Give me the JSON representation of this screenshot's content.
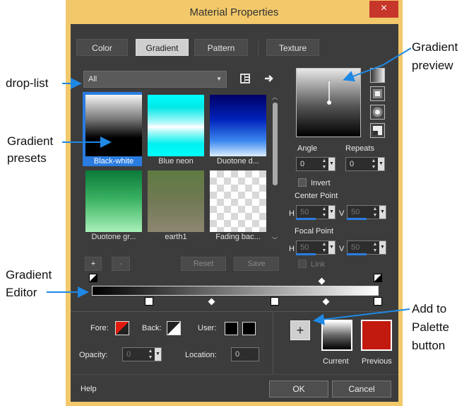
{
  "window": {
    "title": "Material Properties",
    "close_glyph": "×"
  },
  "tabs": [
    {
      "label": "Color",
      "active": false
    },
    {
      "label": "Gradient",
      "active": true
    },
    {
      "label": "Pattern",
      "active": false
    },
    {
      "label": "Texture",
      "active": false
    }
  ],
  "droplist": {
    "value": "All"
  },
  "presets": [
    {
      "label": "Black-white",
      "selected": true
    },
    {
      "label": "Blue neon",
      "selected": false
    },
    {
      "label": "Duotone d...",
      "selected": false
    },
    {
      "label": "Duotone gr...",
      "selected": false
    },
    {
      "label": "earth1",
      "selected": false
    },
    {
      "label": "Fading bac...",
      "selected": false
    }
  ],
  "preset_buttons": {
    "add": "+",
    "remove": "-",
    "reset": "Reset",
    "save": "Save"
  },
  "properties": {
    "angle_label": "Angle",
    "angle_value": "0",
    "repeats_label": "Repeats",
    "repeats_value": "0",
    "invert_label": "Invert",
    "center_point_label": "Center Point",
    "focal_point_label": "Focal Point",
    "h_label": "H",
    "v_label": "V",
    "center_h": "50",
    "center_v": "50",
    "focal_h": "50",
    "focal_v": "50",
    "link_label": "Link"
  },
  "editor": {
    "fore_label": "Fore:",
    "back_label": "Back:",
    "user_label": "User:",
    "opacity_label": "Opacity:",
    "opacity_value": "0",
    "location_label": "Location:",
    "location_value": "0"
  },
  "palette": {
    "add_glyph": "+",
    "current_label": "Current",
    "previous_label": "Previous",
    "previous_color": "#c21a0e"
  },
  "footer": {
    "help": "Help",
    "ok": "OK",
    "cancel": "Cancel"
  },
  "annotations": {
    "drop_list": "drop-list",
    "gradient_presets_1": "Gradient",
    "gradient_presets_2": "presets",
    "gradient_editor_1": "Gradient",
    "gradient_editor_2": "Editor",
    "gradient_preview_1": "Gradient",
    "gradient_preview_2": "preview",
    "add_palette_1": "Add to",
    "add_palette_2": "Palette",
    "add_palette_3": "button"
  },
  "colors": {
    "accent": "#2a7ce0",
    "frame": "#f2c86a",
    "close": "#c7362b",
    "client": "#3c3c3c"
  }
}
